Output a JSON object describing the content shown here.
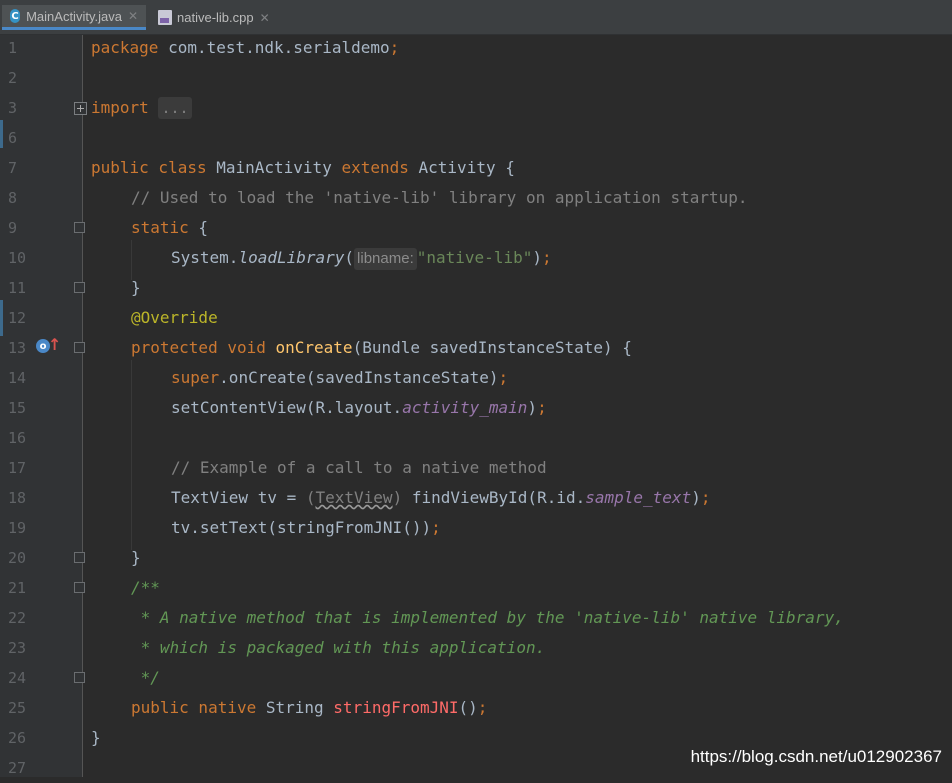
{
  "tabs": [
    {
      "label": "MainActivity.java",
      "icon": "java-class-icon",
      "active": true
    },
    {
      "label": "native-lib.cpp",
      "icon": "cpp-file-icon",
      "active": false
    }
  ],
  "lines": [
    {
      "n": "1"
    },
    {
      "n": "2"
    },
    {
      "n": "3"
    },
    {
      "n": "6"
    },
    {
      "n": "7"
    },
    {
      "n": "8"
    },
    {
      "n": "9"
    },
    {
      "n": "10"
    },
    {
      "n": "11"
    },
    {
      "n": "12"
    },
    {
      "n": "13"
    },
    {
      "n": "14"
    },
    {
      "n": "15"
    },
    {
      "n": "16"
    },
    {
      "n": "17"
    },
    {
      "n": "18"
    },
    {
      "n": "19"
    },
    {
      "n": "20"
    },
    {
      "n": "21"
    },
    {
      "n": "22"
    },
    {
      "n": "23"
    },
    {
      "n": "24"
    },
    {
      "n": "25"
    },
    {
      "n": "26"
    },
    {
      "n": "27"
    }
  ],
  "code": {
    "l1_kw": "package",
    "l1_rest": " com.test.ndk.serialdemo",
    "l1_semi": ";",
    "l3_kw": "import",
    "l3_fold": "...",
    "l7_kw1": "public class",
    "l7_name": " MainActivity ",
    "l7_kw2": "extends",
    "l7_rest": " Activity {",
    "l8": "// Used to load the 'native-lib' library on application startup.",
    "l9_kw": "static",
    "l9_rest": " {",
    "l10_a": "System.",
    "l10_m": "loadLibrary",
    "l10_p": "(",
    "l10_hint": "libname:",
    "l10_str": "\"native-lib\"",
    "l10_end": ")",
    "l10_semi": ";",
    "l11": "}",
    "l12": "@Override",
    "l13_kw": "protected void",
    "l13_m": " onCreate",
    "l13_rest": "(Bundle savedInstanceState) {",
    "l14_kw": "super",
    "l14_rest": ".onCreate(savedInstanceState)",
    "l14_semi": ";",
    "l15_a": "setContentView(R.layout.",
    "l15_f": "activity_main",
    "l15_b": ")",
    "l15_semi": ";",
    "l17": "// Example of a call to a native method",
    "l18_a": "TextView tv = ",
    "l18_cast": "(",
    "l18_type": "TextView",
    "l18_cast2": ")",
    "l18_b": " findViewById(R.id.",
    "l18_f": "sample_text",
    "l18_c": ")",
    "l18_semi": ";",
    "l19_a": "tv.setText(stringFromJNI())",
    "l19_semi": ";",
    "l20": "}",
    "l21": "/**",
    "l22": " * A native method that is implemented by the 'native-lib' native library,",
    "l23": " * which is packaged with this application.",
    "l24": " */",
    "l25_kw": "public native",
    "l25_a": " String ",
    "l25_m": "stringFromJNI",
    "l25_b": "()",
    "l25_semi": ";",
    "l26": "}"
  },
  "gutter_icons": {
    "override": "override-method-icon",
    "arrow": "implements-arrow-icon"
  },
  "watermark": "https://blog.csdn.net/u012902367",
  "colors": {
    "keyword": "#cc7832",
    "comment": "#808080",
    "doc": "#629755",
    "string": "#6a8759",
    "method": "#ffc66d",
    "field": "#9876aa",
    "annotation": "#bbb529",
    "native": "#ff6b68",
    "background": "#2b2b2b"
  }
}
